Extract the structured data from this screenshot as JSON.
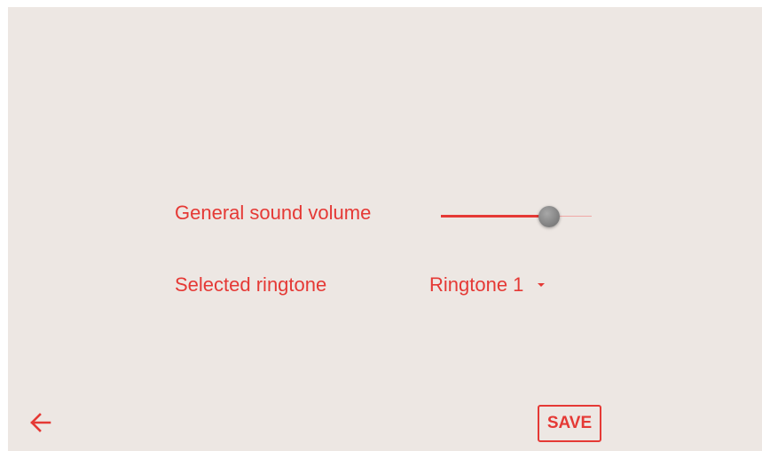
{
  "colors": {
    "accent": "#e53935",
    "background": "#ede7e3",
    "thumb": "#8a8a8a"
  },
  "settings": {
    "volume_label": "General sound volume",
    "volume_level": 0.72,
    "ringtone_label": "Selected ringtone",
    "ringtone_value": "Ringtone 1"
  },
  "footer": {
    "back_icon": "arrow-left-icon",
    "save_label": "SAVE"
  }
}
